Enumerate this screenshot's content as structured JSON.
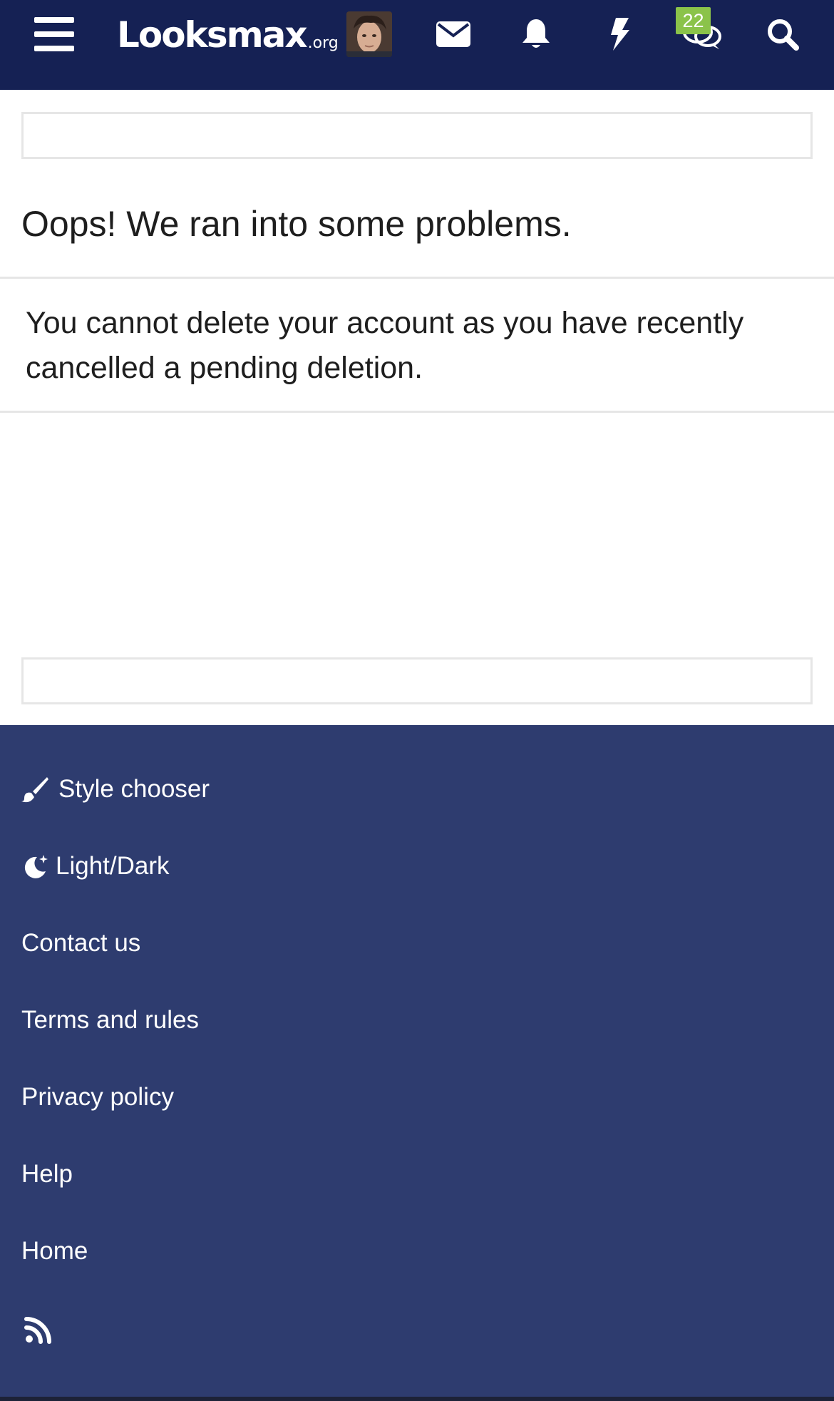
{
  "header": {
    "logo_main": "Looksmax",
    "logo_suffix": ".org",
    "badge_count": "22",
    "icons": [
      "menu-icon",
      "avatar",
      "mail-icon",
      "bell-icon",
      "bolt-icon",
      "chat-icon",
      "search-icon"
    ],
    "background": "#152154",
    "badge_color": "#8bc34a"
  },
  "main": {
    "title": "Oops! We ran into some problems.",
    "error_message": "You cannot delete your account as you have recently cancelled a pending deletion."
  },
  "footer": {
    "background": "#2e3c6f",
    "links": [
      {
        "label": "Style chooser",
        "icon": "paintbrush-icon"
      },
      {
        "label": "Light/Dark",
        "icon": "moon-icon"
      },
      {
        "label": "Contact us"
      },
      {
        "label": "Terms and rules"
      },
      {
        "label": "Privacy policy"
      },
      {
        "label": "Help"
      },
      {
        "label": "Home"
      },
      {
        "label": "",
        "icon": "rss-icon"
      }
    ]
  }
}
